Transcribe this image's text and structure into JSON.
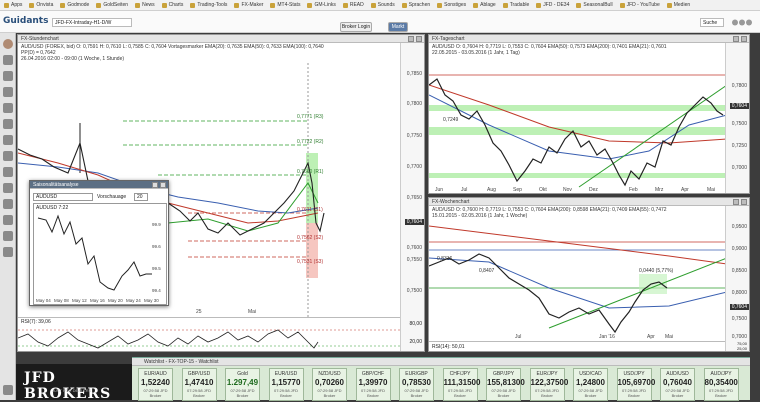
{
  "bookmarks": [
    "Apps",
    "Onvista",
    "Godmode",
    "GoldSeiten",
    "News",
    "Charts",
    "Trading-Tools",
    "FX-Maker",
    "MT4-Stats",
    "GM-Links",
    "READ",
    "Sounds",
    "Sprachen",
    "Sonstiges",
    "Ablage",
    "Tradable",
    "JFD - DE34",
    "SeasonalBull",
    "JFD - YouTube",
    "Medien"
  ],
  "app": {
    "logo": "Guidants",
    "workspace": "JFD-FX-Intraday-H1-D/W",
    "login_button": "Broker Login",
    "market_button": "Markt",
    "search_label": "Suche"
  },
  "chart_h1": {
    "title": "FX-Stundenchart",
    "symbol_line": "AUD/USD (FOREX, bid)  O: 0,7591  H: 0,7610  L: 0,7585  C: 0,7604  Vortagesmarker  EMA(20): 0,7635  EMA(50): 0,7633  EMA(100): 0,7640",
    "pivot_line": "PP(D)  = 0,7642",
    "date_line": "26.04.2016 02:00 - 09:00 (1 Woche, 1 Stunde)",
    "levels": [
      "0,7771 (R3)",
      "0,7722 (R2)",
      "0,7660 (R1)",
      "0,7611 (S1)",
      "0,7562 (S2)",
      "0,7531 (S3)"
    ],
    "price_badge": "0,7604",
    "axis_labels": [
      "0,7850",
      "0,7800",
      "0,7750",
      "0,7700",
      "0,7650",
      "0,7600",
      "0,7550",
      "0,7500"
    ],
    "x_labels": [
      "25",
      "Mai"
    ],
    "rsi_label": "RSI(7): 39,06",
    "rsi_axis": [
      "80,00",
      "20,00"
    ]
  },
  "chart_d1": {
    "title": "FX-Tageschart",
    "symbol_line": "AUD/USD  O: 0,7604  H: 0,7719  L: 0,7553  C: 0,7604  EMA(50): 0,7573  EMA(200): 0,7401  EMA(21): 0,7601",
    "date_line": "22.05.2015 - 03.05.2016 (1 Jahr, 1 Tag)",
    "price_badge": "0,7604",
    "inline_label": "0,7249",
    "axis_labels": [
      "0,7800",
      "0,7604",
      "0,7500",
      "0,7250",
      "0,7000"
    ],
    "x_labels": [
      "Jun",
      "Jul",
      "Aug",
      "Sep",
      "Okt",
      "Nov",
      "Dez",
      "Feb",
      "Mrz",
      "Apr",
      "Mai"
    ]
  },
  "chart_w1": {
    "title": "FX-Wochenchart",
    "symbol_line": "AUD/USD  O: 0,7600  H: 0,7719  L: 0,7553  C: 0,7604  EMA(200): 0,8598  EMA(21): 0,7409  EMA(55): 0,7472",
    "date_line": "15.01.2015 - 02.05.2016 (1 Jahr, 1 Woche)",
    "price_badge": "0,7604",
    "box_label": "0,0440 (5,77%)",
    "inline_labels": [
      "0,8316",
      "0,8407"
    ],
    "axis_labels": [
      "0,9500",
      "0,9000",
      "0,8500",
      "0,8000",
      "0,7500",
      "0,7000"
    ],
    "x_labels": [
      "Jul",
      "Jan '16",
      "Apr",
      "Mai"
    ],
    "rsi_label": "RSI(14): 50,01",
    "rsi_axis": [
      "75,00",
      "25,00"
    ]
  },
  "mini": {
    "title": "Saisonalitätsanalyse",
    "symbol": "AUDUSD",
    "mode_label": "Vorschauage",
    "mode_value": "20",
    "inner_label": "AUDUSD 7:22",
    "x_labels": [
      "May 04",
      "May 08",
      "May 12",
      "May 16",
      "May 20",
      "May 24",
      "May 30"
    ],
    "y_labels": [
      "99.9",
      "99.6",
      "99.5",
      "99.4"
    ]
  },
  "watchlist": {
    "title": "Watchlist - FX-TOP-15 - Watchlist",
    "tiles": [
      {
        "name": "EUR/AUD",
        "price": "1,52240",
        "stamp": "07:29:58 JFD Broker",
        "up": false
      },
      {
        "name": "GBP/USD",
        "price": "1,47410",
        "stamp": "07:29:58 JFD Broker",
        "up": false
      },
      {
        "name": "Gold",
        "price": "1.297,49",
        "stamp": "07:29:58 JFD Broker",
        "up": true
      },
      {
        "name": "EUR/USD",
        "price": "1,15770",
        "stamp": "07:29:58 JFD Broker",
        "up": false
      },
      {
        "name": "NZD/USD",
        "price": "0,70260",
        "stamp": "07:29:58 JFD Broker",
        "up": false
      },
      {
        "name": "GBP/CHF",
        "price": "1,39970",
        "stamp": "07:29:58 JFD Broker",
        "up": false
      },
      {
        "name": "EUR/GBP",
        "price": "0,78530",
        "stamp": "07:29:58 JFD Broker",
        "up": false
      },
      {
        "name": "CHF/JPY",
        "price": "111,31500",
        "stamp": "07:29:58 JFD Broker",
        "up": false
      },
      {
        "name": "GBP/JPY",
        "price": "155,81300",
        "stamp": "07:29:58 JFD Broker",
        "up": false
      },
      {
        "name": "EUR/JPY",
        "price": "122,37500",
        "stamp": "07:29:58 JFD Broker",
        "up": false
      },
      {
        "name": "USD/CAD",
        "price": "1,24800",
        "stamp": "07:29:58 JFD Broker",
        "up": false
      },
      {
        "name": "USD/JPY",
        "price": "105,69700",
        "stamp": "07:29:58 JFD Broker",
        "up": false
      },
      {
        "name": "AUD/USD",
        "price": "0,76040",
        "stamp": "07:29:58 JFD Broker",
        "up": false
      },
      {
        "name": "AUD/JPY",
        "price": "80,35400",
        "stamp": "07:29:58 JFD Broker",
        "up": false
      }
    ]
  },
  "branding": {
    "logo_main": "JFD BROKERS",
    "logo_sub": "JUST FOR DEALERS"
  },
  "colors": {
    "bull": "#2a8a2a",
    "bear": "#111111",
    "ema_red": "#c0392b",
    "ema_blue": "#3a5fb0",
    "ema_green": "#2e9e2e",
    "zone": "#bdf0b5"
  }
}
